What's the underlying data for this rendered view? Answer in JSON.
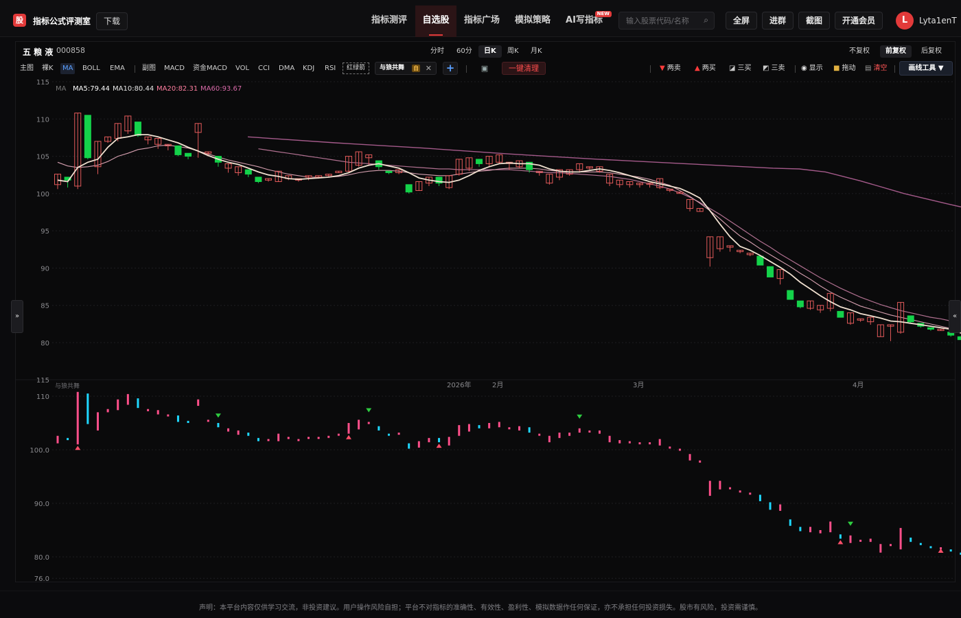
{
  "header": {
    "logo_char": "股",
    "brand": "指标公式评测室",
    "download": "下载",
    "nav": [
      {
        "label": "指标测评",
        "active": false
      },
      {
        "label": "自选股",
        "active": true
      },
      {
        "label": "指标广场",
        "active": false
      },
      {
        "label": "模拟策略",
        "active": false
      },
      {
        "label": "AI写指标",
        "active": false,
        "badge": "NEW"
      }
    ],
    "search_placeholder": "输入股票代码/名称",
    "buttons": {
      "fullscreen": "全屏",
      "join_group": "进群",
      "screenshot": "截图",
      "membership": "开通会员"
    },
    "avatar_letter": "L",
    "username": "Lyta1enT"
  },
  "stock": {
    "name": "五 粮 液",
    "code": "000858"
  },
  "periods": [
    {
      "label": "分时",
      "active": false
    },
    {
      "label": "60分",
      "active": false
    },
    {
      "label": "日K",
      "active": true
    },
    {
      "label": "周K",
      "active": false
    },
    {
      "label": "月K",
      "active": false
    }
  ],
  "adjust": [
    {
      "label": "不复权",
      "active": false
    },
    {
      "label": "前复权",
      "active": true
    },
    {
      "label": "后复权",
      "active": false
    }
  ],
  "indicators_main": [
    "主图",
    "裸K",
    "MA",
    "BOLL",
    "EMA"
  ],
  "indicators_sub": [
    "副图",
    "MACD",
    "资金MACD",
    "VOL",
    "CCI",
    "DMA",
    "KDJ",
    "RSI"
  ],
  "red_green_arrow": "红绿箭",
  "custom_indicator": {
    "name": "与狼共舞",
    "badge": "自"
  },
  "clear_all": "一键清理",
  "signals": [
    {
      "icon": "▼",
      "color": "#ff3b3b",
      "label": "两卖"
    },
    {
      "icon": "▲",
      "color": "#ff3b3b",
      "label": "两买"
    },
    {
      "icon": "⬔",
      "color": "#c0c0c0",
      "label": "三买"
    },
    {
      "icon": "⬕",
      "color": "#c0c0c0",
      "label": "三卖"
    },
    {
      "icon": "◉",
      "color": "#e0e0e0",
      "label": "显示"
    },
    {
      "icon": "🔒",
      "color": "#e0b040",
      "label": "拖动"
    },
    {
      "icon": "🗑",
      "color": "#ff5555",
      "label": "清空"
    }
  ],
  "draw_tool": "画线工具 ▼",
  "ma_legend": {
    "label": "MA",
    "ma5": "MA5:79.44",
    "ma10": "MA10:80.44",
    "ma20": "MA20:82.31",
    "ma60": "MA60:93.67"
  },
  "sub_title": "与狼共舞",
  "footer": "声明：本平台内容仅供学习交流，非投资建议。用户操作风险自担；平台不对指标的准确性、有效性、盈利性、模拟数据作任何保证，亦不承担任何投资损失。股市有风险，投资需谨慎。",
  "colors": {
    "up": "#e35a5a",
    "down": "#14d24a",
    "sub_up": "#ff4f8a",
    "sub_down": "#1fd8ff",
    "ma5": "#f0e0d0",
    "ma10": "#d6a0b0",
    "ma20": "#b07090",
    "ma60": "#a45a8a"
  },
  "chart_data": {
    "type": "candlestick",
    "main": {
      "y_ticks": [
        115,
        110,
        105,
        100,
        95,
        90,
        85,
        80
      ],
      "ylim": [
        76,
        115
      ],
      "candles": [
        [
          101.2,
          102.6,
          100.6,
          102.2
        ],
        [
          102.2,
          101.8,
          100.8,
          100.8
        ],
        [
          101.0,
          110.8,
          100.6,
          110.8
        ],
        [
          110.5,
          104.8,
          104.6,
          104.8
        ],
        [
          103.6,
          107.0,
          102.6,
          106.2
        ],
        [
          107.0,
          107.6,
          106.8,
          107.4
        ],
        [
          107.4,
          109.4,
          107.0,
          108.8
        ],
        [
          108.4,
          110.4,
          108.0,
          109.6
        ],
        [
          109.6,
          107.8,
          107.6,
          107.8
        ],
        [
          107.2,
          107.6,
          106.6,
          106.8
        ],
        [
          106.6,
          107.4,
          106.0,
          107.0
        ],
        [
          106.4,
          106.6,
          105.8,
          106.0
        ],
        [
          106.4,
          105.2,
          105.0,
          105.2
        ],
        [
          105.4,
          105.0,
          104.6,
          104.6
        ],
        [
          108.2,
          109.4,
          104.8,
          105.2
        ],
        [
          105.4,
          105.6,
          105.0,
          105.0
        ],
        [
          105.0,
          104.2,
          103.6,
          103.6
        ],
        [
          103.4,
          104.0,
          102.8,
          103.8
        ],
        [
          102.8,
          103.6,
          102.4,
          103.0
        ],
        [
          103.2,
          102.6,
          102.2,
          102.6
        ],
        [
          102.2,
          101.6,
          101.4,
          101.4
        ],
        [
          101.8,
          102.0,
          101.6,
          101.8
        ],
        [
          101.6,
          103.0,
          101.6,
          102.6
        ],
        [
          102.0,
          102.4,
          101.8,
          101.8
        ],
        [
          101.8,
          102.0,
          101.6,
          102.0
        ],
        [
          102.2,
          102.4,
          101.8,
          102.0
        ],
        [
          102.2,
          102.4,
          102.0,
          102.0
        ],
        [
          102.6,
          102.6,
          102.2,
          102.4
        ],
        [
          102.8,
          103.0,
          102.8,
          102.8
        ],
        [
          103.0,
          105.0,
          102.8,
          105.0
        ],
        [
          103.8,
          105.6,
          103.6,
          104.2
        ],
        [
          104.8,
          105.2,
          103.8,
          104.2
        ],
        [
          104.4,
          103.6,
          103.2,
          103.4
        ],
        [
          103.0,
          102.8,
          102.6,
          102.6
        ],
        [
          102.8,
          103.2,
          102.6,
          102.8
        ],
        [
          101.2,
          100.2,
          100.0,
          100.2
        ],
        [
          100.4,
          101.6,
          100.4,
          101.4
        ],
        [
          101.4,
          102.2,
          101.0,
          102.0
        ],
        [
          102.2,
          101.4,
          101.0,
          101.4
        ],
        [
          100.8,
          102.4,
          100.6,
          102.4
        ],
        [
          102.6,
          104.6,
          102.4,
          104.0
        ],
        [
          103.4,
          104.8,
          103.0,
          103.6
        ],
        [
          104.6,
          104.0,
          103.6,
          104.0
        ],
        [
          104.0,
          105.0,
          103.6,
          104.6
        ],
        [
          104.2,
          105.2,
          104.0,
          105.2
        ],
        [
          104.2,
          104.2,
          103.2,
          103.4
        ],
        [
          103.6,
          104.4,
          103.4,
          104.4
        ],
        [
          104.2,
          103.2,
          102.8,
          103.4
        ],
        [
          102.8,
          103.0,
          102.4,
          102.4
        ],
        [
          101.4,
          102.6,
          101.2,
          102.0
        ],
        [
          102.2,
          103.2,
          101.8,
          102.8
        ],
        [
          102.6,
          103.2,
          102.4,
          103.0
        ],
        [
          103.2,
          104.0,
          102.8,
          103.6
        ],
        [
          103.6,
          103.6,
          103.2,
          103.4
        ],
        [
          103.0,
          103.6,
          102.8,
          103.2
        ],
        [
          101.4,
          102.6,
          101.0,
          101.8
        ],
        [
          101.2,
          101.8,
          100.8,
          101.6
        ],
        [
          101.2,
          101.6,
          100.8,
          101.4
        ],
        [
          101.2,
          101.4,
          100.8,
          101.2
        ],
        [
          101.4,
          101.4,
          100.8,
          100.8
        ],
        [
          100.8,
          102.0,
          100.6,
          101.0
        ],
        [
          100.6,
          100.6,
          100.2,
          100.2
        ],
        [
          100.2,
          100.2,
          100.0,
          100.0
        ],
        [
          98.0,
          99.2,
          97.6,
          98.8
        ],
        [
          97.6,
          98.0,
          97.6,
          97.8
        ],
        [
          91.4,
          94.2,
          90.2,
          92.6
        ],
        [
          92.6,
          94.2,
          92.2,
          92.6
        ],
        [
          92.8,
          93.0,
          92.2,
          92.4
        ],
        [
          92.2,
          92.4,
          92.0,
          92.0
        ],
        [
          91.8,
          92.0,
          91.6,
          92.0
        ],
        [
          91.6,
          90.4,
          90.4,
          90.6
        ],
        [
          90.2,
          88.8,
          88.8,
          89.0
        ],
        [
          88.6,
          89.8,
          87.8,
          89.2
        ],
        [
          87.0,
          85.8,
          85.8,
          85.8
        ],
        [
          85.6,
          84.8,
          84.6,
          84.8
        ],
        [
          84.6,
          85.6,
          84.4,
          84.8
        ],
        [
          84.4,
          85.0,
          84.0,
          84.6
        ],
        [
          84.6,
          86.6,
          84.2,
          84.4
        ],
        [
          84.2,
          83.4,
          83.4,
          83.4
        ],
        [
          82.6,
          84.0,
          82.4,
          83.6
        ],
        [
          83.2,
          83.2,
          82.8,
          83.0
        ],
        [
          82.8,
          83.4,
          82.4,
          83.4
        ],
        [
          80.8,
          82.4,
          80.8,
          82.2
        ],
        [
          82.2,
          82.4,
          80.2,
          80.4
        ],
        [
          81.4,
          85.4,
          81.2,
          83.8
        ],
        [
          83.6,
          82.8,
          82.6,
          82.8
        ],
        [
          82.6,
          82.2,
          82.0,
          82.2
        ],
        [
          82.0,
          81.8,
          81.6,
          81.8
        ],
        [
          81.8,
          81.8,
          81.6,
          81.6
        ],
        [
          81.4,
          81.0,
          80.8,
          81.0
        ],
        [
          80.8,
          80.4,
          80.4,
          80.4
        ],
        [
          80.4,
          79.6,
          79.2,
          79.6
        ],
        [
          79.4,
          79.4,
          78.8,
          79.0
        ],
        [
          79.0,
          79.0,
          78.8,
          79.0
        ],
        [
          79.0,
          79.6,
          79.0,
          79.6
        ],
        [
          79.4,
          80.8,
          79.2,
          79.8
        ],
        [
          79.8,
          79.8,
          79.4,
          79.6
        ]
      ],
      "ma5": [
        101.8,
        101.6,
        103.5,
        104.2,
        104.6,
        106.2,
        107.4,
        107.6,
        107.9,
        107.9,
        107.6,
        107.2,
        106.8,
        106.2,
        105.7,
        105.1,
        104.6,
        104.2,
        103.9,
        103.4,
        102.9,
        102.5,
        102.3,
        102.0,
        101.9,
        102.0,
        102.1,
        102.2,
        102.4,
        102.8,
        103.4,
        103.8,
        104.0,
        103.7,
        103.4,
        102.8,
        102.1,
        101.8,
        101.6,
        101.5,
        101.8,
        102.4,
        103.1,
        103.6,
        104.0,
        104.1,
        104.0,
        104.0,
        103.8,
        103.3,
        103.0,
        102.9,
        102.9,
        103.1,
        103.3,
        103.1,
        102.8,
        102.4,
        102.0,
        101.6,
        101.3,
        101.0,
        100.7,
        100.1,
        99.4,
        97.7,
        95.9,
        94.2,
        92.9,
        92.4,
        91.7,
        90.9,
        90.1,
        89.2,
        88.1,
        87.2,
        86.3,
        85.5,
        84.8,
        84.4,
        83.9,
        83.6,
        83.3,
        82.9,
        82.8,
        82.6,
        82.4,
        82.2,
        82.0,
        81.8,
        81.3,
        80.8,
        80.3,
        79.9,
        79.6,
        79.4,
        79.4
      ],
      "ma10": [
        104.2,
        103.7,
        103.5,
        103.6,
        103.8,
        104.3,
        105.0,
        105.4,
        105.9,
        106.1,
        106.4,
        106.5,
        106.3,
        106.1,
        105.7,
        105.3,
        104.9,
        104.5,
        104.2,
        103.9,
        103.6,
        103.2,
        102.9,
        102.6,
        102.4,
        102.2,
        102.2,
        102.2,
        102.3,
        102.5,
        102.8,
        103.0,
        103.1,
        103.1,
        103.0,
        102.8,
        102.6,
        102.5,
        102.4,
        102.4,
        102.6,
        102.8,
        103.0,
        103.1,
        103.3,
        103.4,
        103.4,
        103.4,
        103.3,
        103.1,
        103.0,
        102.9,
        102.9,
        102.9,
        102.9,
        102.8,
        102.6,
        102.4,
        102.2,
        101.9,
        101.5,
        101.1,
        100.4,
        99.6,
        98.7,
        97.7,
        96.6,
        95.4,
        94.3,
        93.5,
        92.6,
        91.8,
        91.0,
        90.2,
        89.3,
        88.5,
        87.6,
        86.8,
        86.1,
        85.5,
        84.9,
        84.5,
        84.1,
        83.7,
        83.4,
        83.1,
        82.8,
        82.5,
        82.2,
        81.9,
        81.6,
        81.3,
        81.0,
        80.7,
        80.5,
        80.4,
        80.4
      ],
      "ma20": [
        null,
        null,
        null,
        null,
        null,
        null,
        null,
        null,
        null,
        null,
        null,
        null,
        null,
        null,
        null,
        null,
        null,
        null,
        null,
        null,
        106.0,
        105.8,
        105.6,
        105.4,
        105.2,
        105.0,
        104.8,
        104.6,
        104.4,
        104.2,
        104.1,
        104.0,
        103.9,
        103.8,
        103.7,
        103.6,
        103.5,
        103.4,
        103.3,
        103.3,
        103.2,
        103.2,
        103.2,
        103.2,
        103.2,
        103.2,
        103.1,
        103.0,
        102.9,
        102.8,
        102.8,
        102.7,
        102.6,
        102.5,
        102.4,
        102.3,
        102.1,
        101.9,
        101.6,
        101.3,
        101.0,
        100.6,
        100.1,
        99.5,
        98.8,
        98.0,
        97.2,
        96.3,
        95.4,
        94.5,
        93.6,
        92.8,
        91.9,
        91.1,
        90.3,
        89.5,
        88.7,
        88.0,
        87.3,
        86.7,
        86.1,
        85.6,
        85.1,
        84.7,
        84.3,
        84.0,
        83.7,
        83.4,
        83.2,
        82.9,
        82.6,
        82.4,
        82.3,
        82.3,
        82.3,
        82.3,
        82.3
      ],
      "ma60": [
        null,
        null,
        null,
        null,
        null,
        null,
        null,
        null,
        null,
        null,
        null,
        null,
        null,
        null,
        null,
        null,
        null,
        null,
        null,
        null,
        null,
        null,
        null,
        null,
        null,
        null,
        null,
        null,
        null,
        null,
        null,
        null,
        null,
        null,
        null,
        null,
        null,
        null,
        null,
        null,
        null,
        null,
        null,
        null,
        null,
        null,
        null,
        null,
        null,
        null,
        null,
        null,
        null,
        null,
        null,
        null,
        null,
        null,
        null,
        null,
        null,
        null,
        null,
        null,
        null,
        null,
        null,
        null,
        null,
        null,
        null,
        null,
        null,
        null,
        null,
        null,
        null,
        null,
        null,
        null,
        null,
        null,
        null,
        null,
        null,
        null,
        null,
        null,
        null,
        null,
        null,
        null,
        null,
        null,
        null,
        null,
        null
      ],
      "ma60_line": [
        [
          0.0,
          107.6
        ],
        [
          10.0,
          106.8
        ],
        [
          20.0,
          106.1
        ],
        [
          30.0,
          105.3
        ],
        [
          40.0,
          104.6
        ],
        [
          50.0,
          104.0
        ],
        [
          60.0,
          103.4
        ],
        [
          63.0,
          103.3
        ],
        [
          66.0,
          102.9
        ],
        [
          70.0,
          101.7
        ],
        [
          75.0,
          100.0
        ],
        [
          80.0,
          98.6
        ],
        [
          85.0,
          97.3
        ],
        [
          90.0,
          96.2
        ],
        [
          96.0,
          94.0
        ]
      ]
    },
    "sub": {
      "y_ticks": [
        115,
        110,
        100.0,
        90.0,
        80.0,
        76.0
      ],
      "ylim": [
        76,
        115
      ],
      "x_labels": [
        "2026年",
        "2月",
        "3月",
        "4月"
      ]
    }
  }
}
